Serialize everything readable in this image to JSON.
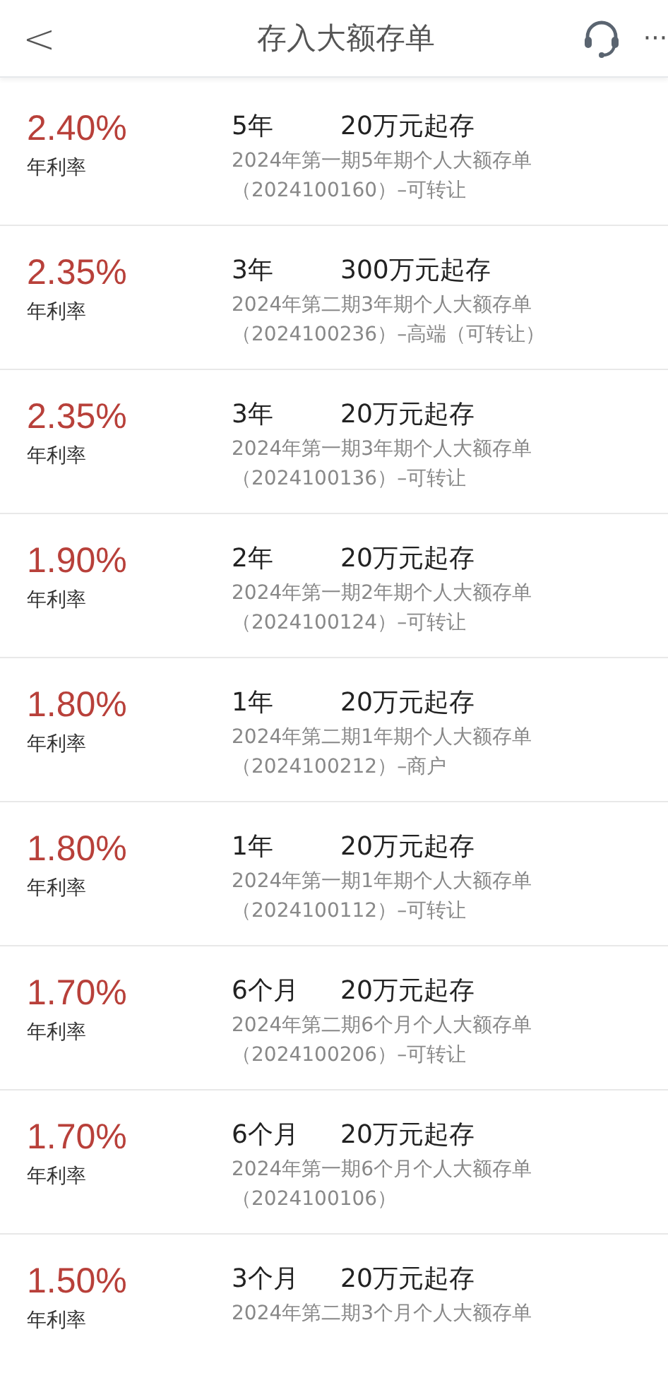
{
  "header": {
    "back": "<",
    "title": "存入大额存单",
    "more": "···"
  },
  "products": [
    {
      "rate": "2.40%",
      "rate_label": "年利率",
      "term": "5年",
      "min_amount": "20万元起存",
      "desc": [
        "2024年第一期5年期个人大额存单",
        "（2024100160）–可转让"
      ]
    },
    {
      "rate": "2.35%",
      "rate_label": "年利率",
      "term": "3年",
      "min_amount": "300万元起存",
      "desc": [
        "2024年第二期3年期个人大额存单",
        "（2024100236）–高端（可转让）"
      ]
    },
    {
      "rate": "2.35%",
      "rate_label": "年利率",
      "term": "3年",
      "min_amount": "20万元起存",
      "desc": [
        "2024年第一期3年期个人大额存单",
        "（2024100136）–可转让"
      ]
    },
    {
      "rate": "1.90%",
      "rate_label": "年利率",
      "term": "2年",
      "min_amount": "20万元起存",
      "desc": [
        "2024年第一期2年期个人大额存单",
        "（2024100124）–可转让"
      ]
    },
    {
      "rate": "1.80%",
      "rate_label": "年利率",
      "term": "1年",
      "min_amount": "20万元起存",
      "desc": [
        "2024年第二期1年期个人大额存单",
        "（2024100212）–商户"
      ]
    },
    {
      "rate": "1.80%",
      "rate_label": "年利率",
      "term": "1年",
      "min_amount": "20万元起存",
      "desc": [
        "2024年第一期1年期个人大额存单",
        "（2024100112）–可转让"
      ]
    },
    {
      "rate": "1.70%",
      "rate_label": "年利率",
      "term": "6个月",
      "min_amount": "20万元起存",
      "desc": [
        "2024年第二期6个月个人大额存单",
        "（2024100206）–可转让"
      ]
    },
    {
      "rate": "1.70%",
      "rate_label": "年利率",
      "term": "6个月",
      "min_amount": "20万元起存",
      "desc": [
        "2024年第一期6个月个人大额存单",
        "（2024100106）"
      ]
    },
    {
      "rate": "1.50%",
      "rate_label": "年利率",
      "term": "3个月",
      "min_amount": "20万元起存",
      "desc": [
        "2024年第二期3个月个人大额存单"
      ]
    }
  ]
}
